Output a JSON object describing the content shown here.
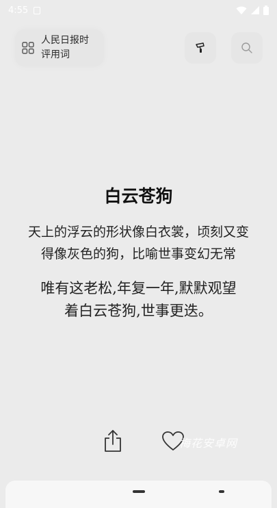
{
  "status_bar": {
    "time": "4:55",
    "icons": [
      "notification-icon",
      "wifi-icon",
      "signal-icon",
      "battery-icon"
    ]
  },
  "header": {
    "category_label": "人民日报时\n评用词",
    "category_icon": "grid-icon",
    "brush_icon": "brush-icon",
    "search_icon": "search-icon"
  },
  "poem": {
    "title": "白云苍狗",
    "explanation": "天上的浮云的形状像白衣裳，顷刻又变得像灰色的狗，比喻世事变幻无常",
    "text": "唯有这老松,年复一年,默默观望着白云苍狗,世事更迭。"
  },
  "actions": {
    "share_icon": "share-icon",
    "like_icon": "heart-icon"
  },
  "watermark": "梅花安卓网",
  "colors": {
    "background": "#ebebeb",
    "text": "#1a1a1a",
    "status_text": "#ffffff"
  }
}
